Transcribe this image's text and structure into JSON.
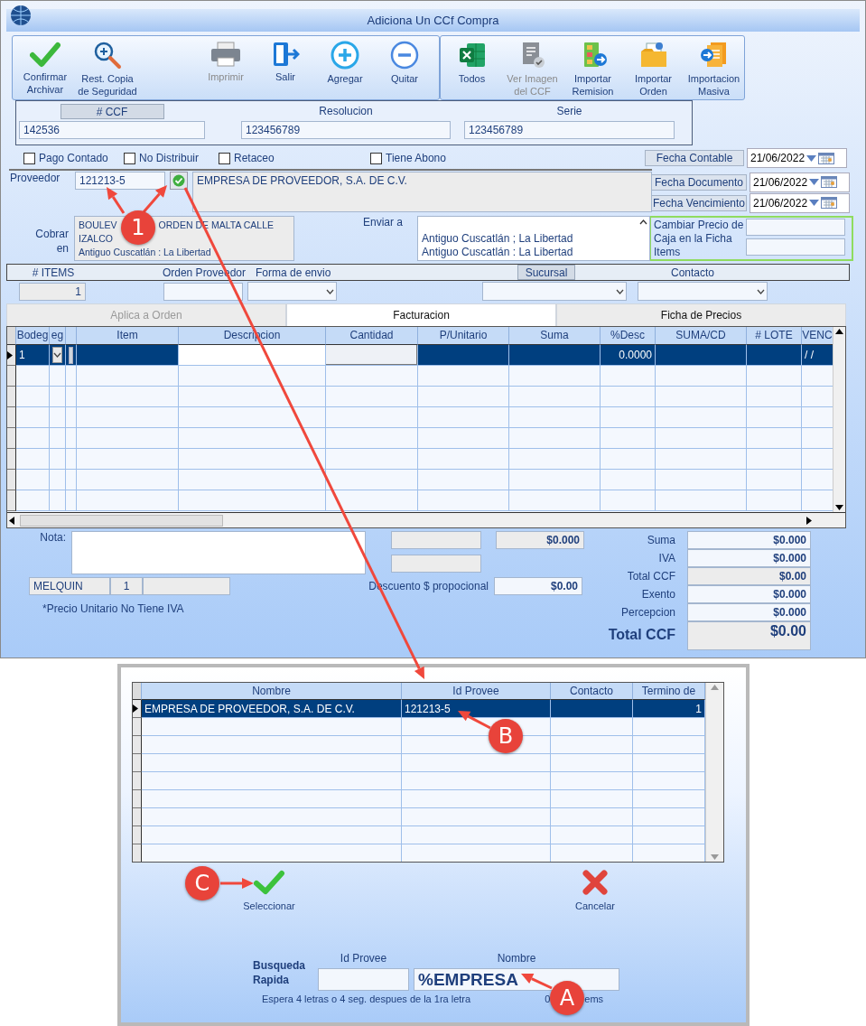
{
  "window": {
    "title": "Adiciona Un CCf Compra"
  },
  "toolbar": {
    "groups": [
      {
        "buttons": [
          {
            "lines": [
              "Confirmar",
              "Archivar"
            ],
            "disabled": false
          },
          {
            "lines": [
              "Rest. Copia",
              "de Seguridad"
            ],
            "disabled": false
          },
          {
            "lines": [
              "Imprimir"
            ],
            "disabled": true
          },
          {
            "lines": [
              "Salir"
            ],
            "disabled": false
          },
          {
            "lines": [
              "Agregar"
            ],
            "disabled": false
          },
          {
            "lines": [
              "Quitar"
            ],
            "disabled": false
          }
        ]
      },
      {
        "buttons": [
          {
            "lines": [
              "Todos"
            ],
            "disabled": false
          },
          {
            "lines": [
              "Ver Imagen",
              "del CCF"
            ],
            "disabled": true
          },
          {
            "lines": [
              "Importar",
              "Remision"
            ],
            "disabled": false
          },
          {
            "lines": [
              "Importar",
              "Orden"
            ],
            "disabled": false
          },
          {
            "lines": [
              "Importacion",
              "Masiva"
            ],
            "disabled": false
          }
        ]
      }
    ]
  },
  "header": {
    "ccf_label": "# CCF",
    "ccf": "142536",
    "resolucion_label": "Resolucion",
    "resolucion": "123456789",
    "serie_label": "Serie",
    "serie": "123456789"
  },
  "checkboxes": [
    {
      "label": "Pago Contado",
      "checked": false
    },
    {
      "label": "No Distribuir",
      "checked": false
    },
    {
      "label": "Retaceo",
      "checked": false
    },
    {
      "label": "Tiene Abono",
      "checked": false
    }
  ],
  "fecha_contable": {
    "label": "Fecha Contable",
    "value": "21/06/2022"
  },
  "proveedor": {
    "label": "Proveedor",
    "id": "121213-5",
    "name": "EMPRESA DE PROVEEDOR, S.A. DE C.V."
  },
  "fecha_documento": {
    "label": "Fecha Documento",
    "value": "21/06/2022"
  },
  "fecha_vencimiento": {
    "label": "Fecha Vencimiento",
    "value": "21/06/2022"
  },
  "cobrar_en": {
    "label": "Cobrar en",
    "line_1_parts": [
      "BOULEV",
      "ORDEN DE MALTA CALLE"
    ],
    "lines": [
      "IZALCO",
      "Antiguo Cuscatlán : La Libertad"
    ]
  },
  "enviar_a": {
    "label": "Enviar a",
    "lines": [
      "Antiguo Cuscatlán ; La Libertad",
      "Antiguo Cuscatlán : La Libertad"
    ]
  },
  "cambiar_precio": {
    "label": "Cambiar Precio de Caja en la Ficha Items"
  },
  "items_bar": {
    "items_label": "# ITEMS",
    "items_value": "1",
    "orden_label": "Orden Proveedor",
    "forma_label": "Forma de envio",
    "sucursal_label": "Sucursal",
    "contacto_label": "Contacto"
  },
  "tabs": [
    {
      "label": "Aplica a Orden",
      "selected": false,
      "disabled": true
    },
    {
      "label": "Facturacion",
      "selected": true,
      "disabled": false
    },
    {
      "label": "Ficha de Precios",
      "selected": false,
      "disabled": false
    }
  ],
  "grid": {
    "columns": [
      {
        "label": "Bodeg",
        "kind": "text"
      },
      {
        "label": "eg",
        "kind": "dropdown"
      },
      {
        "kind": "button"
      },
      {
        "label": "Item",
        "kind": "text"
      },
      {
        "label": "Descripcion",
        "kind": "editor"
      },
      {
        "label": "Cantidad",
        "kind": "raised"
      },
      {
        "label": "P/Unitario",
        "kind": "text"
      },
      {
        "label": "Suma",
        "kind": "text"
      },
      {
        "label": "%Desc",
        "kind": "number"
      },
      {
        "label": "SUMA/CD",
        "kind": "text"
      },
      {
        "label": "# LOTE",
        "kind": "text"
      },
      {
        "label": "VENC",
        "kind": "text"
      }
    ],
    "rows": [
      {
        "selected": true,
        "cells": [
          "1",
          null,
          null,
          null,
          null,
          null,
          null,
          null,
          "0.0000",
          null,
          null,
          "/ /"
        ]
      }
    ]
  },
  "nota": {
    "label": "Nota:"
  },
  "user_row": {
    "user": "MELQUIN",
    "number": "1"
  },
  "note_text": "*Precio Unitario No Tiene IVA",
  "middle": {
    "value": "$0.000",
    "descuento_label": "Descuento $ propocional",
    "descuento": "$0.00"
  },
  "totals": [
    {
      "label": "Suma",
      "value": "$0.000",
      "kind": "normal"
    },
    {
      "label": "IVA",
      "value": "$0.000",
      "kind": "normal"
    },
    {
      "label": "Total CCF",
      "value": "$0.00",
      "kind": "grey"
    },
    {
      "label": "Exento",
      "value": "$0.000",
      "kind": "normal"
    },
    {
      "label": "Percepcion",
      "value": "$0.000",
      "kind": "normal"
    },
    {
      "label": "Total CCF",
      "value": "$0.00",
      "kind": "big"
    }
  ],
  "dialog": {
    "grid": {
      "columns": [
        "Nombre",
        "Id Provee",
        "Contacto",
        "Termino de"
      ],
      "rows": [
        {
          "selected": true,
          "cells": [
            "EMPRESA DE PROVEEDOR, S.A. DE C.V.",
            "121213-5",
            null,
            "1"
          ]
        }
      ]
    },
    "select_label": "Seleccionar",
    "cancel_label": "Cancelar",
    "search_label": "Busqueda Rapida",
    "id_label": "Id Provee",
    "nombre_label": "Nombre",
    "nombre_value": "%EMPRESA",
    "hint": "Espera 4 letras o 4 seg. despues de la 1ra letra",
    "count_parts": [
      "0",
      "ems"
    ]
  },
  "callouts": [
    {
      "label": "1"
    },
    {
      "label": "B"
    },
    {
      "label": "C"
    },
    {
      "label": "A"
    }
  ]
}
